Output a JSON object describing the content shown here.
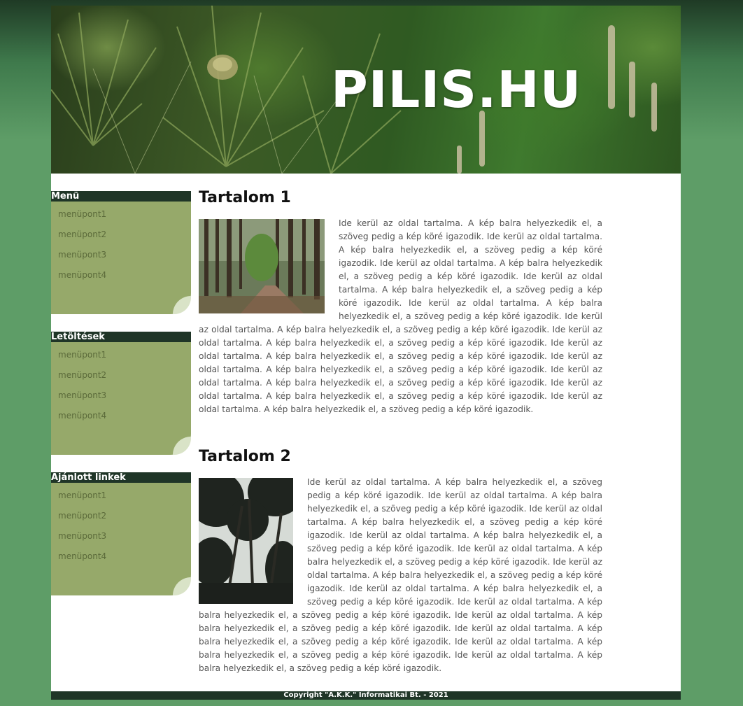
{
  "header": {
    "title": "PILIS.HU"
  },
  "sidebar": {
    "boxes": [
      {
        "title": "Menü",
        "items": [
          "menüpont1",
          "menüpont2",
          "menüpont3",
          "menüpont4"
        ]
      },
      {
        "title": "Letöltések",
        "items": [
          "menüpont1",
          "menüpont2",
          "menüpont3",
          "menüpont4"
        ]
      },
      {
        "title": "Ajánlott linkek",
        "items": [
          "menüpont1",
          "menüpont2",
          "menüpont3",
          "menüpont4"
        ]
      }
    ]
  },
  "content": {
    "sections": [
      {
        "heading": "Tartalom 1",
        "image": "forest-path-photo",
        "text": "Ide kerül az oldal tartalma. A kép balra helyezkedik el, a szöveg pedig a kép köré igazodik. Ide kerül az oldal tartalma. A kép balra helyezkedik el, a szöveg pedig a kép köré igazodik. Ide kerül az oldal tartalma. A kép balra helyezkedik el, a szöveg pedig a kép köré igazodik. Ide kerül az oldal tartalma. A kép balra helyezkedik el, a szöveg pedig a kép köré igazodik. Ide kerül az oldal tartalma. A kép balra helyezkedik el, a szöveg pedig a kép köré igazodik. Ide kerül az oldal tartalma. A kép balra helyezkedik el, a szöveg pedig a kép köré igazodik. Ide kerül az oldal tartalma. A kép balra helyezkedik el, a szöveg pedig a kép köré igazodik. Ide kerül az oldal tartalma. A kép balra helyezkedik el, a szöveg pedig a kép köré igazodik. Ide kerül az oldal tartalma. A kép balra helyezkedik el, a szöveg pedig a kép köré igazodik. Ide kerül az oldal tartalma. A kép balra helyezkedik el, a szöveg pedig a kép köré igazodik. Ide kerül az oldal tartalma. A kép balra helyezkedik el, a szöveg pedig a kép köré igazodik. Ide kerül az oldal tartalma. A kép balra helyezkedik el, a szöveg pedig a kép köré igazodik."
      },
      {
        "heading": "Tartalom 2",
        "image": "tree-canopy-photo",
        "text": "Ide kerül az oldal tartalma. A kép balra helyezkedik el, a szöveg pedig a kép köré igazodik. Ide kerül az oldal tartalma. A kép balra helyezkedik el, a szöveg pedig a kép köré igazodik. Ide kerül az oldal tartalma. A kép balra helyezkedik el, a szöveg pedig a kép köré igazodik. Ide kerül az oldal tartalma. A kép balra helyezkedik el, a szöveg pedig a kép köré igazodik. Ide kerül az oldal tartalma. A kép balra helyezkedik el, a szöveg pedig a kép köré igazodik. Ide kerül az oldal tartalma. A kép balra helyezkedik el, a szöveg pedig a kép köré igazodik. Ide kerül az oldal tartalma. A kép balra helyezkedik el, a szöveg pedig a kép köré igazodik. Ide kerül az oldal tartalma. A kép balra helyezkedik el, a szöveg pedig a kép köré igazodik. Ide kerül az oldal tartalma. A kép balra helyezkedik el, a szöveg pedig a kép köré igazodik. Ide kerül az oldal tartalma. A kép balra helyezkedik el, a szöveg pedig a kép köré igazodik. Ide kerül az oldal tartalma. A kép balra helyezkedik el, a szöveg pedig a kép köré igazodik. Ide kerül az oldal tartalma. A kép balra helyezkedik el, a szöveg pedig a kép köré igazodik."
      }
    ]
  },
  "footer": {
    "copyright": "Copyright \"A.K.K.\" Informatikai Bt. - 2021"
  },
  "colors": {
    "background": "#5e9d67",
    "dark_green": "#1f3527",
    "box_green": "#96a96a",
    "link": "#5b6a3a",
    "text": "#555555"
  }
}
